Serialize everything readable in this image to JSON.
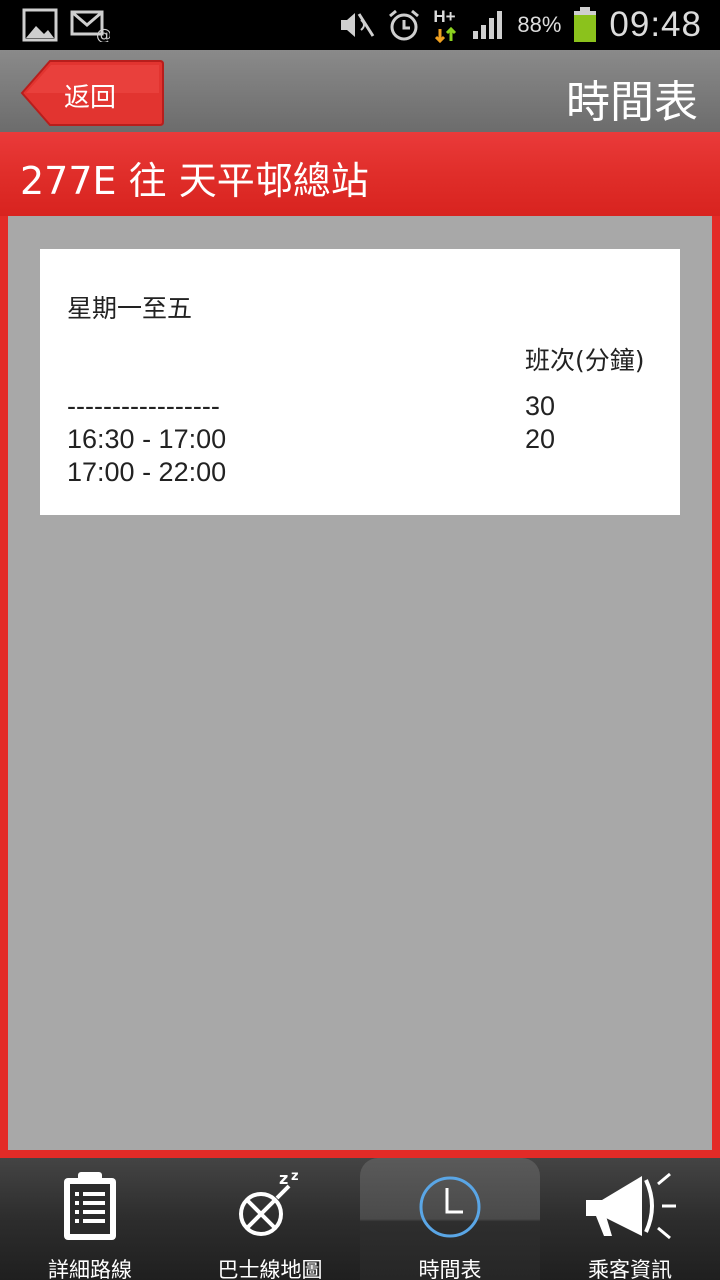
{
  "status_bar": {
    "battery_percent": "88%",
    "time": "09:48",
    "network": "H+",
    "icons": [
      "gallery-icon",
      "email-icon",
      "mute-icon",
      "alarm-icon",
      "network-icon",
      "signal-icon",
      "battery-icon"
    ]
  },
  "titlebar": {
    "back_label": "返回",
    "title": "時間表"
  },
  "route": {
    "header": "277E 往 天平邨總站"
  },
  "timetable": {
    "day": "星期一至五",
    "freq_header": "班次(分鐘)",
    "rows": [
      {
        "period": "-----------------",
        "freq": "30"
      },
      {
        "period": "16:30 - 17:00",
        "freq": "20"
      },
      {
        "period": "17:00 - 22:00",
        "freq": ""
      }
    ]
  },
  "bottom_nav": {
    "items": [
      {
        "label": "詳細路線",
        "icon": "clipboard-icon",
        "active": false
      },
      {
        "label": "巴士線地圖",
        "icon": "map-marker-icon",
        "active": false
      },
      {
        "label": "時間表",
        "icon": "clock-icon",
        "active": true
      },
      {
        "label": "乘客資訊",
        "icon": "megaphone-icon",
        "active": false
      }
    ]
  },
  "colors": {
    "accent_red": "#e02e2a",
    "title_gray": "#7a7a7a",
    "content_gray": "#a8a8a8",
    "clock_blue": "#5aa6e6"
  }
}
